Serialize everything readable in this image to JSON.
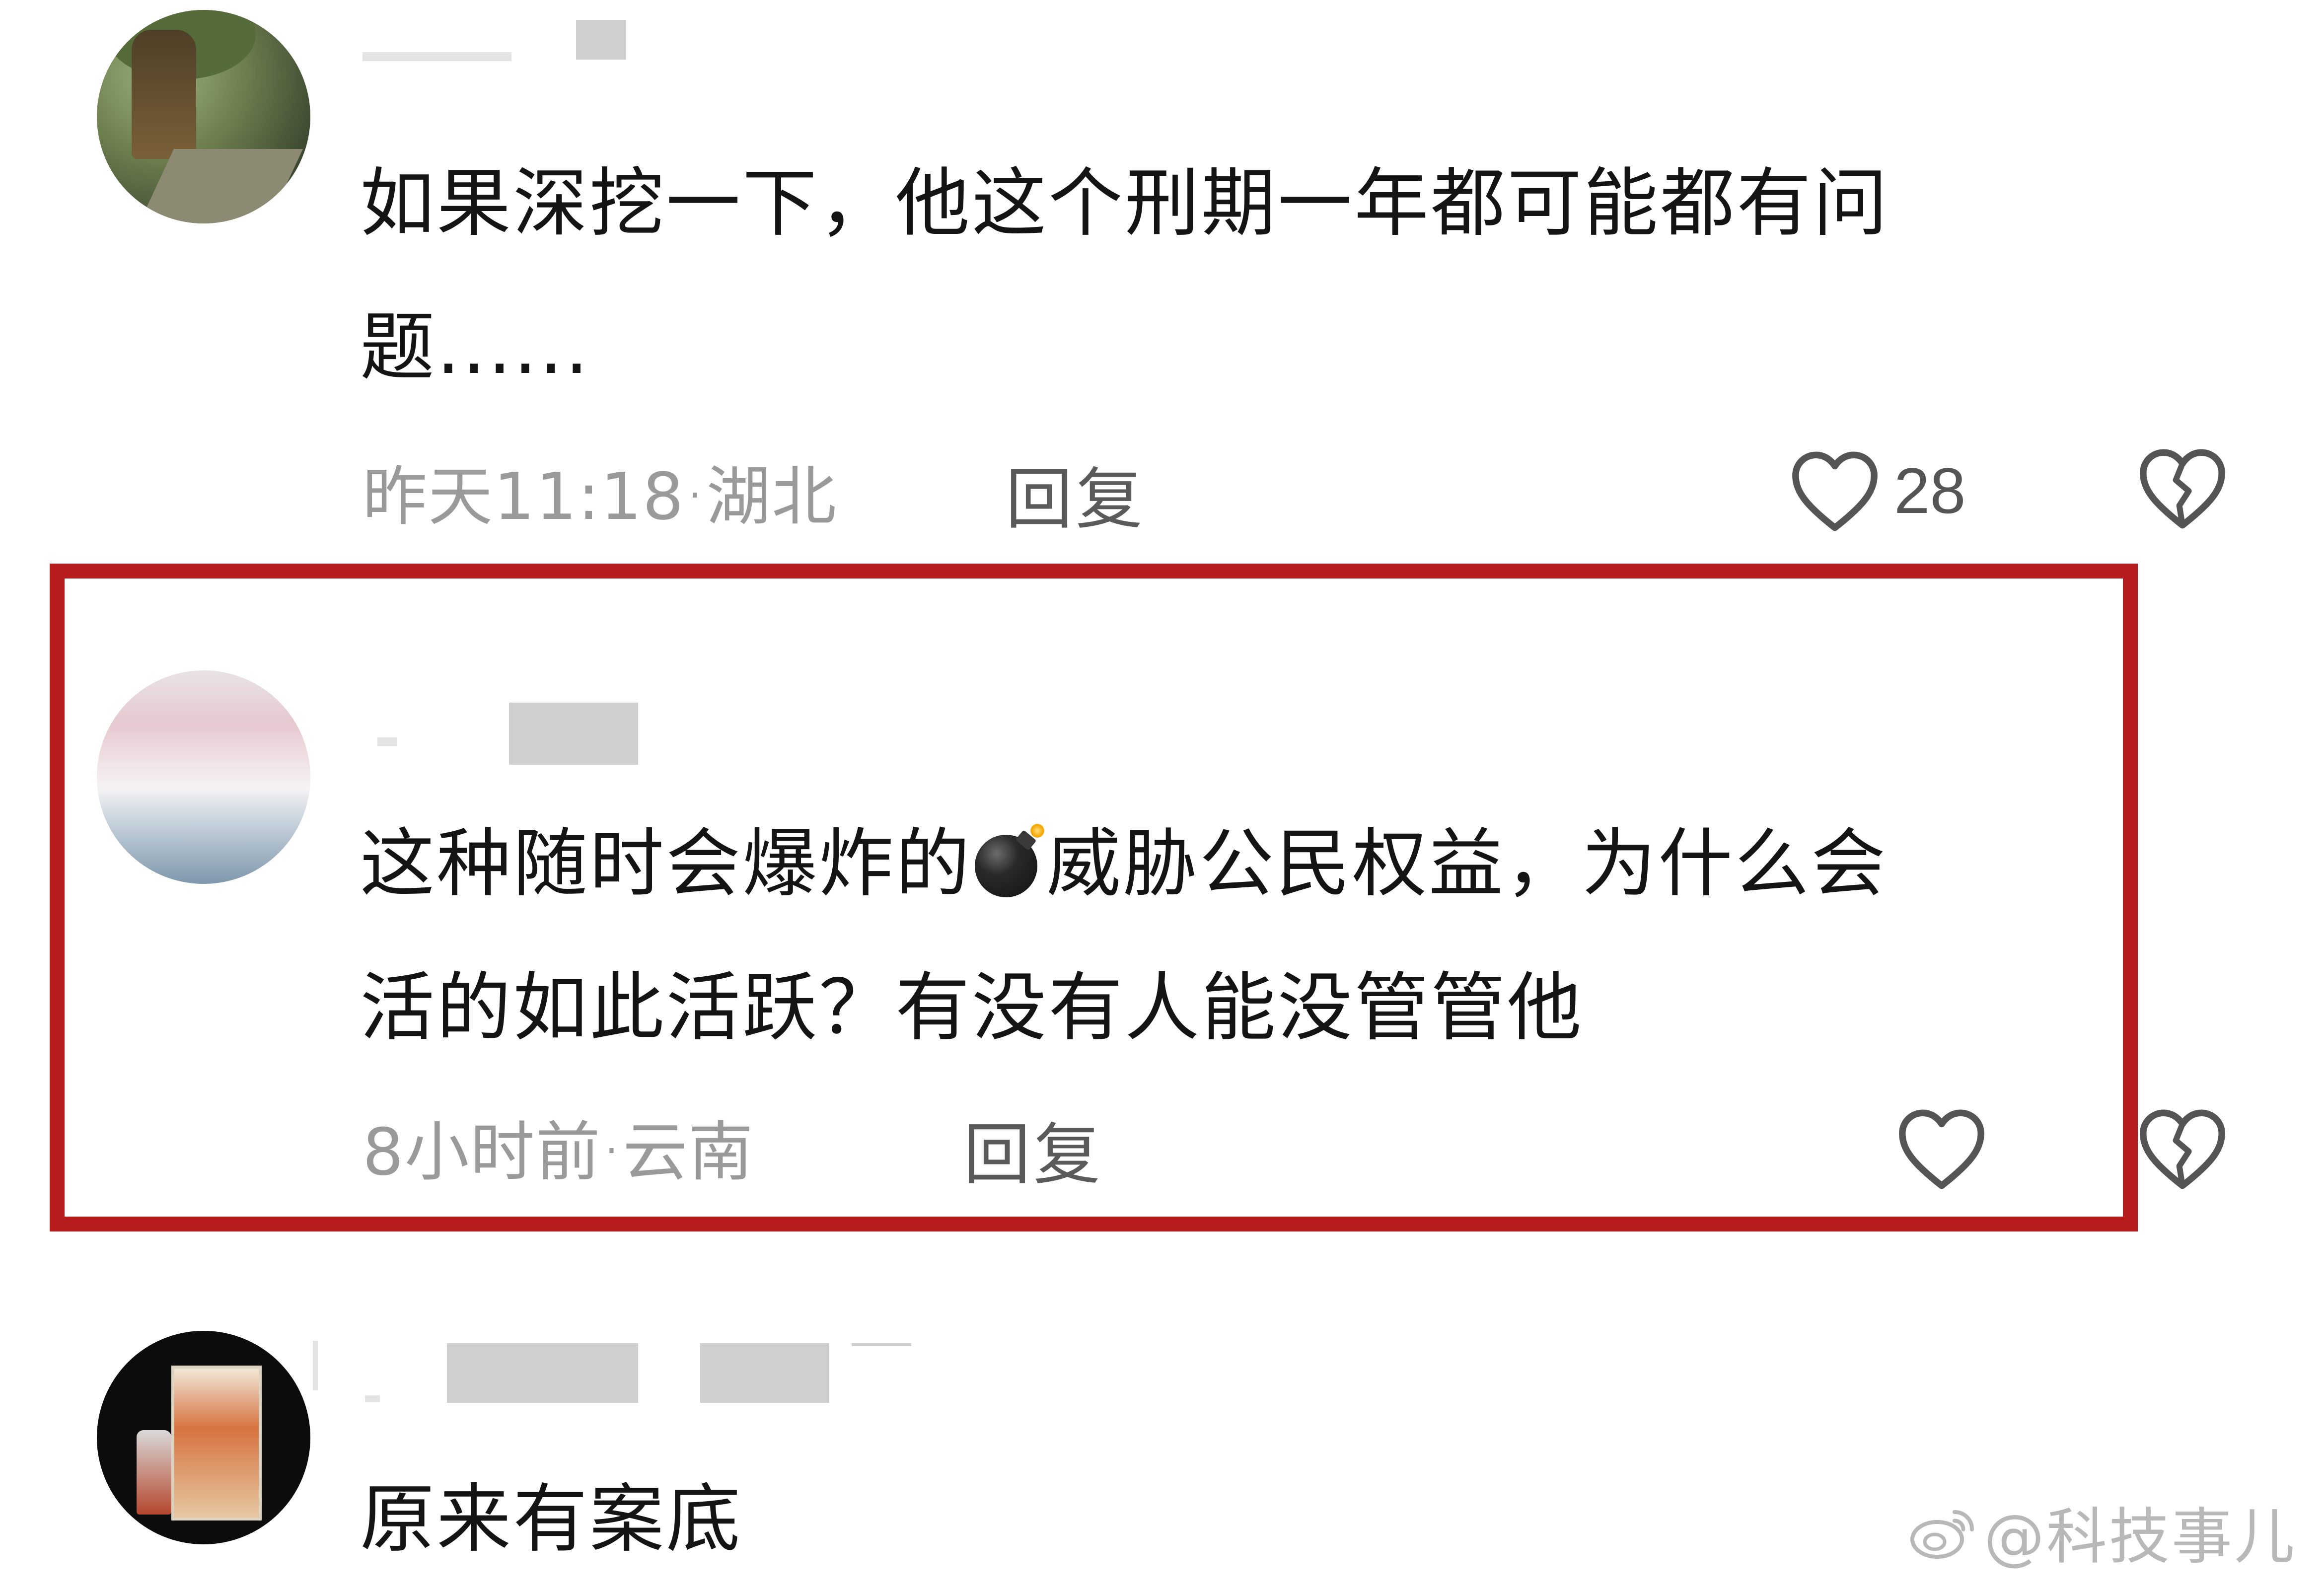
{
  "comments": [
    {
      "content_lines": [
        "如果深挖一下，他这个刑期一年都可能都有问",
        "题......"
      ],
      "time": "昨天11:18",
      "location": "湖北",
      "reply_label": "回复",
      "like_count": "28",
      "icons": [
        "heart-outline-icon",
        "broken-heart-icon"
      ]
    },
    {
      "content_lines_before_emoji": "这种随时会爆炸的",
      "emoji": "bomb-emoji",
      "content_after_emoji": "威胁公民权益，为什么会",
      "content_line2": "活的如此活跃？有没有人能没管管他",
      "time": "8小时前",
      "location": "云南",
      "reply_label": "回复",
      "icons": [
        "heart-outline-icon",
        "broken-heart-icon"
      ]
    },
    {
      "content_lines": [
        "原来有案底"
      ]
    }
  ],
  "watermark": {
    "text": "@科技事儿",
    "icon": "weibo-icon"
  },
  "colors": {
    "highlight_border": "#b71c1c",
    "meta_text": "#9a9a9a",
    "content_text": "#141414"
  }
}
